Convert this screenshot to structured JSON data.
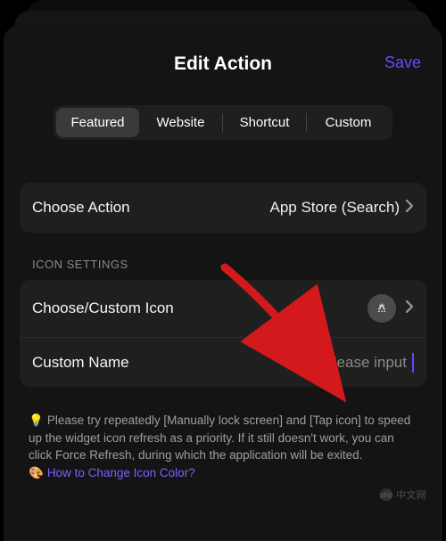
{
  "header": {
    "title": "Edit Action",
    "save_label": "Save"
  },
  "segments": {
    "featured": "Featured",
    "website": "Website",
    "shortcut": "Shortcut",
    "custom": "Custom"
  },
  "choose_action": {
    "label": "Choose Action",
    "value": "App Store (Search)"
  },
  "icon_section": {
    "header": "ICON SETTINGS",
    "choose_icon_label": "Choose/Custom Icon",
    "custom_name_label": "Custom Name",
    "custom_name_placeholder": "Please input"
  },
  "tip": {
    "bulb": "💡",
    "text": "Please try repeatedly [Manually lock screen] and [Tap icon] to speed up the widget icon refresh as a priority. If it still doesn't work, you can click Force Refresh, during which the application will be exited.",
    "palette": "🎨",
    "link": "How to Change Icon Color?"
  },
  "watermark": "中文网"
}
